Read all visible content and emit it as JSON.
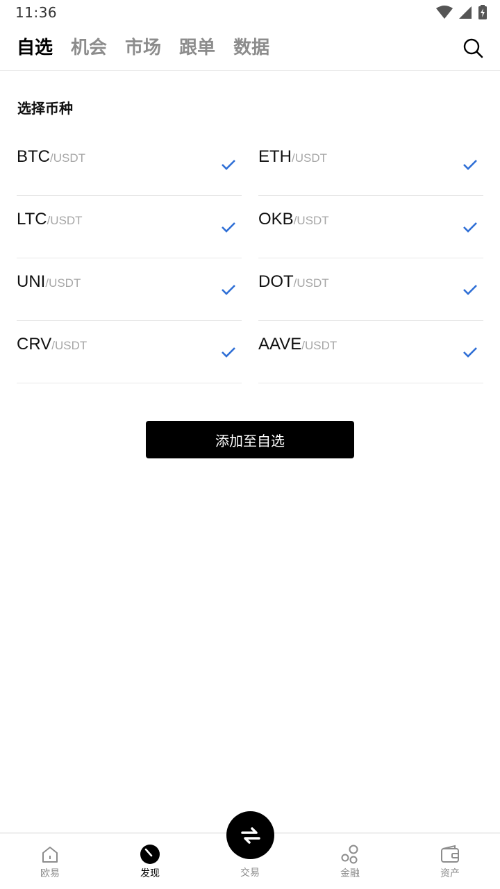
{
  "status_bar": {
    "time": "11:36",
    "icons": [
      "wifi-icon",
      "cell-signal-icon",
      "battery-charging-icon"
    ]
  },
  "top_nav": {
    "tabs": [
      {
        "label": "自选",
        "active": true
      },
      {
        "label": "机会",
        "active": false
      },
      {
        "label": "市场",
        "active": false
      },
      {
        "label": "跟单",
        "active": false
      },
      {
        "label": "数据",
        "active": false
      }
    ],
    "search_icon": "search-icon"
  },
  "section_title": "选择币种",
  "coins": [
    {
      "base": "BTC",
      "quote": "/USDT",
      "checked": true
    },
    {
      "base": "ETH",
      "quote": "/USDT",
      "checked": true
    },
    {
      "base": "LTC",
      "quote": "/USDT",
      "checked": true
    },
    {
      "base": "OKB",
      "quote": "/USDT",
      "checked": true
    },
    {
      "base": "UNI",
      "quote": "/USDT",
      "checked": true
    },
    {
      "base": "DOT",
      "quote": "/USDT",
      "checked": true
    },
    {
      "base": "CRV",
      "quote": "/USDT",
      "checked": true
    },
    {
      "base": "AAVE",
      "quote": "/USDT",
      "checked": true
    }
  ],
  "add_button_label": "添加至自选",
  "bottom_nav": {
    "items": [
      {
        "label": "欧易",
        "icon": "home-icon",
        "active": false
      },
      {
        "label": "发现",
        "icon": "compass-icon",
        "active": true
      },
      {
        "label": "交易",
        "icon": "swap-icon",
        "active": false
      },
      {
        "label": "金融",
        "icon": "finance-circles-icon",
        "active": false
      },
      {
        "label": "资产",
        "icon": "wallet-icon",
        "active": false
      }
    ]
  },
  "colors": {
    "check": "#2f6fd6",
    "text_primary": "#111111",
    "text_muted": "#a6a6a6",
    "button_bg": "#000000"
  }
}
